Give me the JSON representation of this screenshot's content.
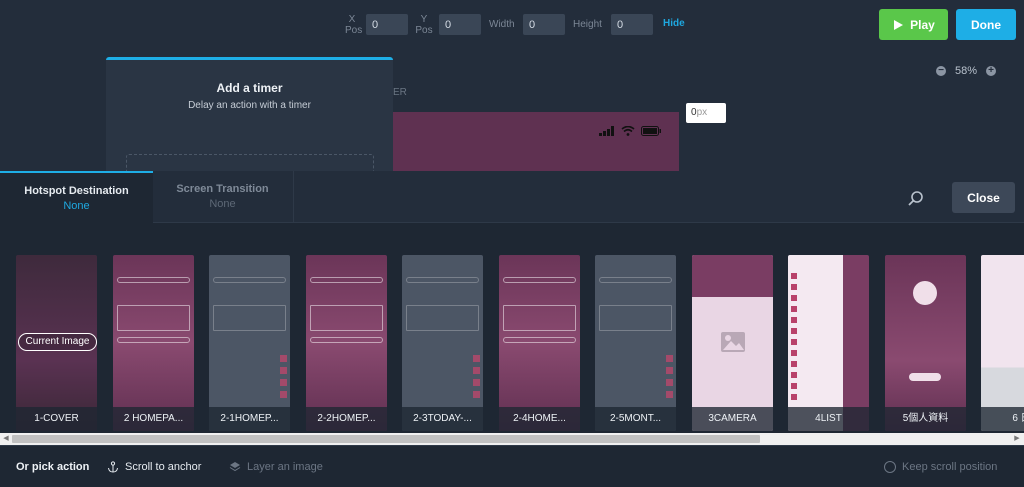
{
  "toolbar": {
    "x_label_1": "X",
    "x_label_2": "Pos",
    "x_value": "0",
    "y_label_1": "Y",
    "y_label_2": "Pos",
    "y_value": "0",
    "width_label": "Width",
    "width_value": "0",
    "height_label": "Height",
    "height_value": "0",
    "hide_label": "Hide",
    "play_label": "Play",
    "done_label": "Done"
  },
  "canvas": {
    "zoom_level": "58%",
    "zoom_out": "−",
    "zoom_in": "+",
    "timer_title": "Add a timer",
    "timer_subtitle": "Delay an action with a timer",
    "behind_text": "ER",
    "px_value": "0",
    "px_unit": "px"
  },
  "tabs": [
    {
      "title": "Hotspot Destination",
      "value": "None"
    },
    {
      "title": "Screen Transition",
      "value": "None"
    }
  ],
  "close_label": "Close",
  "current_image_label": "Current Image",
  "screens": [
    {
      "label": "1-COVER",
      "theme": "cover"
    },
    {
      "label": "2 HOMEPA...",
      "theme": "purple"
    },
    {
      "label": "2-1HOMEP...",
      "theme": "grey"
    },
    {
      "label": "2-2HOMEP...",
      "theme": "purple"
    },
    {
      "label": "2-3TODAY-...",
      "theme": "grey"
    },
    {
      "label": "2-4HOME...",
      "theme": "purple"
    },
    {
      "label": "2-5MONT...",
      "theme": "grey"
    },
    {
      "label": "3CAMERA",
      "theme": "camera"
    },
    {
      "label": "4LIST",
      "theme": "list"
    },
    {
      "label": "5個人資料",
      "theme": "profile"
    },
    {
      "label": "6 日",
      "theme": "keyboard"
    }
  ],
  "bottom": {
    "or_pick_action": "Or pick action",
    "scroll_to_anchor": "Scroll to anchor",
    "layer_an_image": "Layer an image",
    "keep_scroll_position": "Keep scroll position"
  },
  "colors": {
    "accent": "#1eaee6",
    "play": "#5ac74a",
    "purple_screen": "#6b3558",
    "grey_screen": "#4a5463"
  }
}
